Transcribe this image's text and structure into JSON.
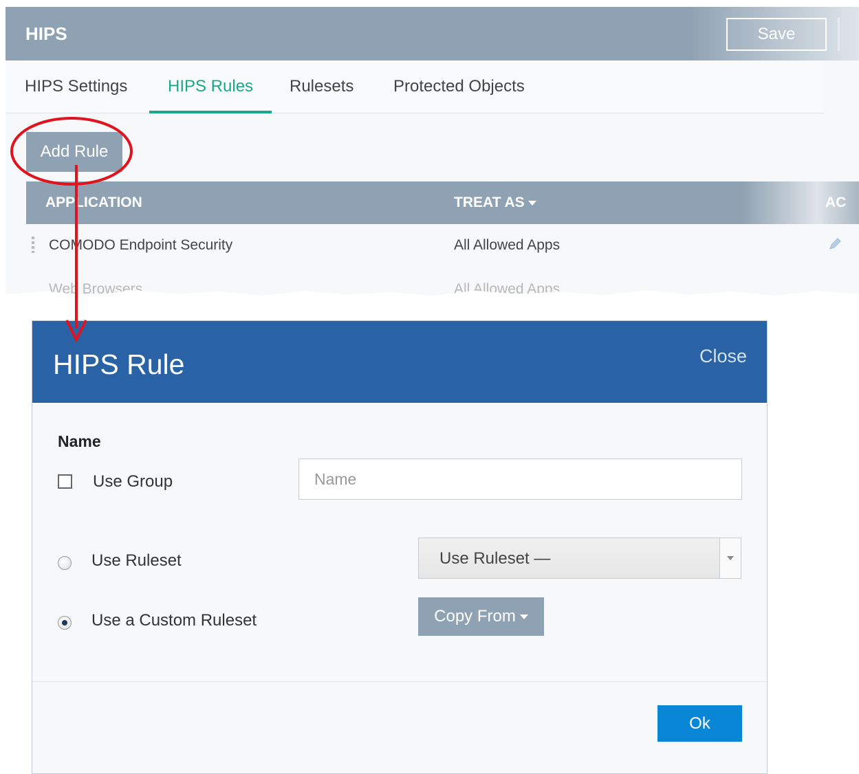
{
  "header": {
    "title": "HIPS",
    "save_label": "Save"
  },
  "tabs": [
    {
      "label": "HIPS Settings"
    },
    {
      "label": "HIPS Rules",
      "active": true
    },
    {
      "label": "Rulesets"
    },
    {
      "label": "Protected Objects"
    }
  ],
  "add_rule_label": "Add Rule",
  "table": {
    "columns": [
      "APPLICATION",
      "TREAT AS",
      "AC"
    ],
    "rows": [
      {
        "application": "COMODO Endpoint Security",
        "treat_as": "All Allowed Apps"
      },
      {
        "application": "Web Browsers",
        "treat_as": "All Allowed Apps"
      }
    ]
  },
  "dialog": {
    "title": "HIPS Rule",
    "close_label": "Close",
    "name_section_label": "Name",
    "use_group_label": "Use Group",
    "name_placeholder": "Name",
    "use_ruleset_label": "Use Ruleset",
    "ruleset_select_value": "Use Ruleset —",
    "custom_ruleset_label": "Use a Custom Ruleset",
    "copy_from_label": "Copy From",
    "ok_label": "Ok"
  },
  "colors": {
    "header_bg": "#8fa2b3",
    "active_tab": "#1aa88c",
    "dialog_header": "#2a62a6",
    "ok_button": "#0a86d6",
    "annotation": "#e0141e"
  }
}
